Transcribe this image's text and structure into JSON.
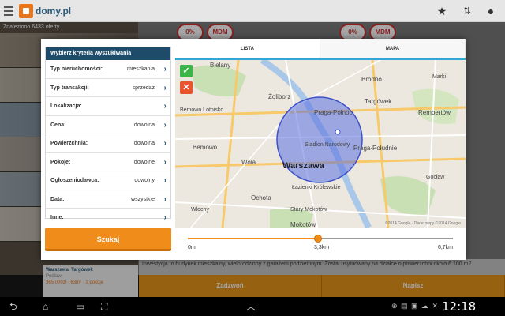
{
  "app": {
    "logo_text": "domy.pl"
  },
  "actionbar": {
    "menu_icon": "menu-icon",
    "icons": [
      "star-icon",
      "sort-icon",
      "map-pin-icon"
    ]
  },
  "listing_bg": {
    "found_text": "Znaleziono 6433 oferty",
    "promo_badges": [
      "0%",
      "MDM",
      "0%",
      "MDM"
    ],
    "card": {
      "title": "Warszawa, Targówek",
      "subtitle": "Podlaw",
      "price": "365 000zł · 63m² · 3 pokoje"
    },
    "description": "Inwestycja to budynek mieszkalny, wielorodzinny z garażem podziemnym. Został usytuowany na działce o powierzchni około 6 100 m2.",
    "call_button": "Zadzwoń",
    "write_button": "Napisz"
  },
  "filters": {
    "header": "Wybierz kryteria wyszukiwania",
    "criteria": [
      {
        "label": "Typ nieruchomości:",
        "value": "mieszkania"
      },
      {
        "label": "Typ transakcji:",
        "value": "sprzedaż"
      },
      {
        "label": "Lokalizacja:",
        "value": ""
      },
      {
        "label": "Cena:",
        "value": "dowolna"
      },
      {
        "label": "Powierzchnia:",
        "value": "dowolna"
      },
      {
        "label": "Pokoje:",
        "value": "dowolne"
      },
      {
        "label": "Ogłoszeniodawca:",
        "value": "dowolny"
      },
      {
        "label": "Data:",
        "value": "wszystkie"
      },
      {
        "label": "Inne:",
        "value": ""
      }
    ],
    "search_button": "Szukaj"
  },
  "tabs": [
    {
      "label": "LISTA",
      "active": false
    },
    {
      "label": "MAPA",
      "active": true
    }
  ],
  "map": {
    "confirm_icon": "checkmark-icon",
    "cancel_icon": "close-icon",
    "city_label": "Warszawa",
    "district_labels": [
      "Bielany",
      "Żoliborz",
      "Praga-Północ",
      "Targówek",
      "Bródno",
      "Rembertów",
      "Bemowo",
      "Wola",
      "Praga-Południe",
      "Ochota",
      "Stadion Narodowy",
      "Gocław",
      "Mokotów",
      "Łazienki Królewskie",
      "Stary Mokotów",
      "Włochy",
      "Marki",
      "Bemowo Lotnisko"
    ],
    "attribution": "©2014 Google · Dane mapy ©2014 Google",
    "circle_color": "#5b6fe0"
  },
  "radius_slider": {
    "min_label": "0m",
    "value_label": "3,3km",
    "max_label": "6,7km",
    "value_fraction": 0.49,
    "accent": "#f08c1a"
  },
  "navbar": {
    "clock": "12:18",
    "icons": [
      "back-icon",
      "home-icon",
      "recent-apps-icon",
      "screenshot-icon",
      "up-arrow-icon"
    ]
  }
}
